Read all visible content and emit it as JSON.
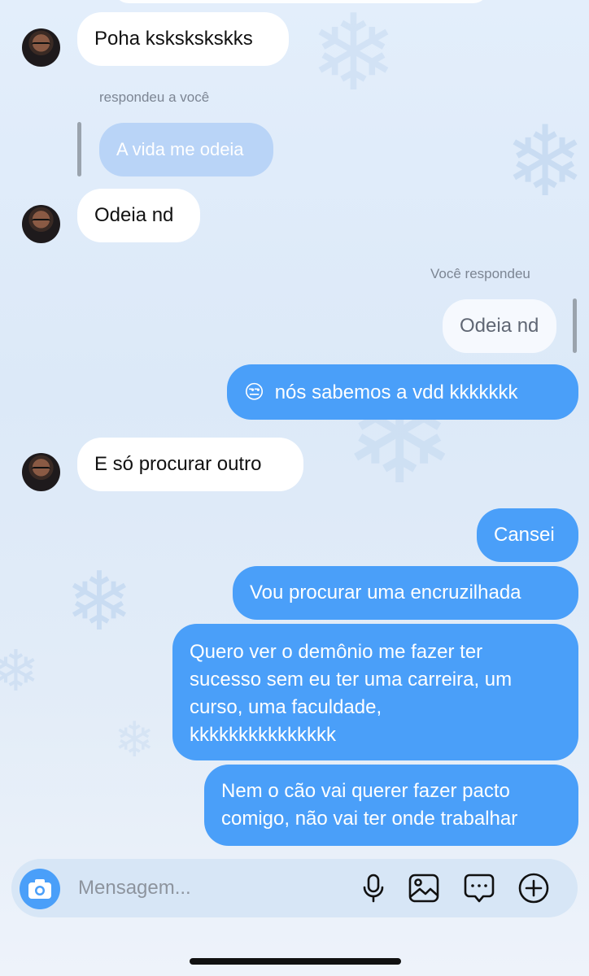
{
  "messages": {
    "m1": "Poha kskskskskks",
    "reply_label_in": "respondeu a você",
    "reply_quote_in": "A vida me odeia",
    "m2": "Odeia nd",
    "reply_label_out": "Você respondeu",
    "reply_quote_out": "Odeia nd",
    "m3_emoji": "😒",
    "m3_text": "nós sabemos a vdd kkkkkkk",
    "m4": "E só procurar outro",
    "m5": "Cansei",
    "m6": "Vou procurar uma encruzilhada",
    "m7_lines": [
      "Quero ver o demônio me fazer ter",
      "sucesso sem eu ter uma carreira, um",
      "curso, uma faculdade,",
      "kkkkkkkkkkkkkkk"
    ],
    "m8_lines": [
      "Nem o cão vai querer fazer pacto",
      "comigo, não vai ter onde trabalhar"
    ]
  },
  "composer": {
    "placeholder": "Mensagem...",
    "icons": [
      "camera-icon",
      "microphone-icon",
      "gallery-icon",
      "sticker-icon",
      "add-icon"
    ]
  },
  "colors": {
    "accent": "#4a9ff9",
    "incoming": "#ffffff",
    "background": "#dfeaf8"
  }
}
